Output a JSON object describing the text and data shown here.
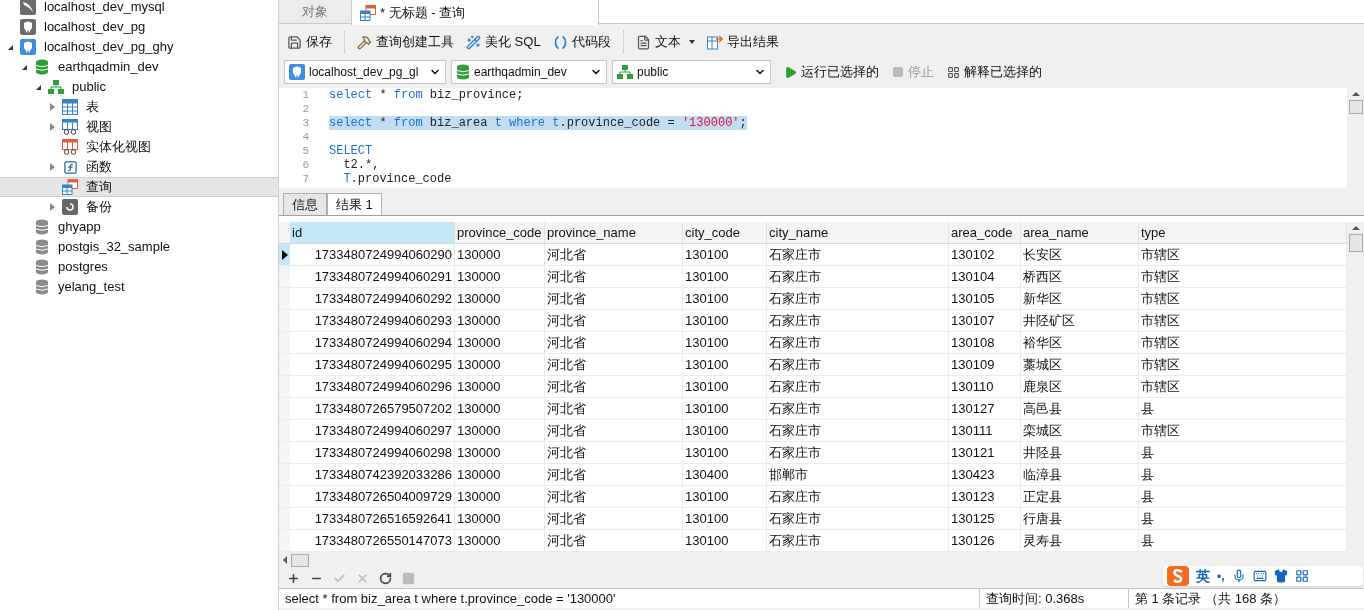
{
  "sidebar": {
    "items": [
      {
        "label": "localhost_dev_mysql",
        "kind": "server-mysql",
        "expanded": false,
        "selected": false
      },
      {
        "label": "localhost_dev_pg",
        "kind": "server-pg",
        "expanded": false,
        "selected": false
      },
      {
        "label": "localhost_dev_pg_ghy",
        "kind": "server-pg-active",
        "expanded": true,
        "selected": false,
        "children": [
          {
            "label": "earthqadmin_dev",
            "kind": "db-open",
            "expanded": true,
            "selected": false,
            "children": [
              {
                "label": "public",
                "kind": "schema",
                "expanded": true,
                "selected": false,
                "children": [
                  {
                    "label": "表",
                    "kind": "table",
                    "expanded": false,
                    "expandable": true,
                    "selected": false
                  },
                  {
                    "label": "视图",
                    "kind": "view",
                    "expanded": false,
                    "expandable": true,
                    "selected": false
                  },
                  {
                    "label": "实体化视图",
                    "kind": "mview",
                    "expanded": false,
                    "expandable": false,
                    "selected": false
                  },
                  {
                    "label": "函数",
                    "kind": "function",
                    "expanded": false,
                    "expandable": true,
                    "selected": false
                  },
                  {
                    "label": "查询",
                    "kind": "query",
                    "expanded": false,
                    "expandable": false,
                    "selected": true
                  },
                  {
                    "label": "备份",
                    "kind": "backup",
                    "expanded": false,
                    "expandable": true,
                    "selected": false
                  }
                ]
              }
            ]
          },
          {
            "label": "ghyapp",
            "kind": "db",
            "expanded": false,
            "selected": false
          },
          {
            "label": "postgis_32_sample",
            "kind": "db",
            "expanded": false,
            "selected": false
          },
          {
            "label": "postgres",
            "kind": "db",
            "expanded": false,
            "selected": false
          },
          {
            "label": "yelang_test",
            "kind": "db",
            "expanded": false,
            "selected": false
          }
        ]
      }
    ]
  },
  "tabs": [
    {
      "label": "对象",
      "selected": false
    },
    {
      "label": "* 无标题 - 查询",
      "selected": true
    }
  ],
  "toolbar": [
    {
      "label": "保存",
      "kind": "save"
    },
    {
      "label": "查询创建工具",
      "kind": "builder"
    },
    {
      "label": "美化 SQL",
      "kind": "beautify"
    },
    {
      "label": "代码段",
      "kind": "snippet"
    },
    {
      "label": "文本",
      "kind": "text"
    },
    {
      "label": "导出结果",
      "kind": "export"
    }
  ],
  "connection_bar": {
    "connection": "localhost_dev_pg_gl",
    "database": "earthqadmin_dev",
    "schema": "public",
    "actions": [
      {
        "label": "运行已选择的",
        "kind": "run",
        "disabled": false
      },
      {
        "label": "停止",
        "kind": "stop",
        "disabled": true
      },
      {
        "label": "解释已选择的",
        "kind": "explain",
        "disabled": false
      }
    ]
  },
  "editor": {
    "lines": [
      {
        "number": "1",
        "code": "select * from biz_province;",
        "selected": false
      },
      {
        "number": "2"
      },
      {
        "number": "3",
        "code": "select * from biz_area t where t.province_code = '130000';",
        "selected": true
      },
      {
        "number": "4"
      },
      {
        "number": "5",
        "code": "SELECT",
        "selected": false
      },
      {
        "number": "6",
        "code": "  t2.*,",
        "selected": false
      },
      {
        "number": "7",
        "code": "  T.province_code",
        "selected": false
      }
    ]
  },
  "result_tabs": [
    {
      "label": "信息",
      "selected": false
    },
    {
      "label": "结果 1",
      "selected": true
    }
  ],
  "table": {
    "columns": [
      "id",
      "province_code",
      "province_name",
      "city_code",
      "city_name",
      "area_code",
      "area_name",
      "type"
    ],
    "rows": [
      {
        "selected": true,
        "cells": [
          "1733480724994060290",
          "130000",
          "河北省",
          "130100",
          "石家庄市",
          "130102",
          "长安区",
          "市辖区"
        ]
      },
      {
        "selected": false,
        "cells": [
          "1733480724994060291",
          "130000",
          "河北省",
          "130100",
          "石家庄市",
          "130104",
          "桥西区",
          "市辖区"
        ]
      },
      {
        "selected": false,
        "cells": [
          "1733480724994060292",
          "130000",
          "河北省",
          "130100",
          "石家庄市",
          "130105",
          "新华区",
          "市辖区"
        ]
      },
      {
        "selected": false,
        "cells": [
          "1733480724994060293",
          "130000",
          "河北省",
          "130100",
          "石家庄市",
          "130107",
          "井陉矿区",
          "市辖区"
        ]
      },
      {
        "selected": false,
        "cells": [
          "1733480724994060294",
          "130000",
          "河北省",
          "130100",
          "石家庄市",
          "130108",
          "裕华区",
          "市辖区"
        ]
      },
      {
        "selected": false,
        "cells": [
          "1733480724994060295",
          "130000",
          "河北省",
          "130100",
          "石家庄市",
          "130109",
          "藁城区",
          "市辖区"
        ]
      },
      {
        "selected": false,
        "cells": [
          "1733480724994060296",
          "130000",
          "河北省",
          "130100",
          "石家庄市",
          "130110",
          "鹿泉区",
          "市辖区"
        ]
      },
      {
        "selected": false,
        "cells": [
          "1733480726579507202",
          "130000",
          "河北省",
          "130100",
          "石家庄市",
          "130127",
          "高邑县",
          "县"
        ]
      },
      {
        "selected": false,
        "cells": [
          "1733480724994060297",
          "130000",
          "河北省",
          "130100",
          "石家庄市",
          "130111",
          "栾城区",
          "市辖区"
        ]
      },
      {
        "selected": false,
        "cells": [
          "1733480724994060298",
          "130000",
          "河北省",
          "130100",
          "石家庄市",
          "130121",
          "井陉县",
          "县"
        ]
      },
      {
        "selected": false,
        "cells": [
          "1733480742392033286",
          "130000",
          "河北省",
          "130400",
          "邯郸市",
          "130423",
          "临漳县",
          "县"
        ]
      },
      {
        "selected": false,
        "cells": [
          "1733480726504009729",
          "130000",
          "河北省",
          "130100",
          "石家庄市",
          "130123",
          "正定县",
          "县"
        ]
      },
      {
        "selected": false,
        "cells": [
          "1733480726516592641",
          "130000",
          "河北省",
          "130100",
          "石家庄市",
          "130125",
          "行唐县",
          "县"
        ]
      },
      {
        "selected": false,
        "cells": [
          "1733480726550147073",
          "130000",
          "河北省",
          "130100",
          "石家庄市",
          "130126",
          "灵寿县",
          "县"
        ]
      }
    ]
  },
  "grid_toolbar": [
    {
      "kind": "add",
      "disabled": false
    },
    {
      "kind": "remove",
      "disabled": false
    },
    {
      "kind": "apply",
      "disabled": true
    },
    {
      "kind": "cancel",
      "disabled": true
    },
    {
      "kind": "refresh",
      "disabled": false
    },
    {
      "kind": "stop",
      "disabled": true
    }
  ],
  "status_bar": {
    "sql": "select * from biz_area t where t.province_code = '130000'",
    "time": "查询时间: 0.368s",
    "records": "第 1 条记录 （共 168 条）"
  },
  "ime": {
    "label": "英",
    "marks": "•,"
  }
}
